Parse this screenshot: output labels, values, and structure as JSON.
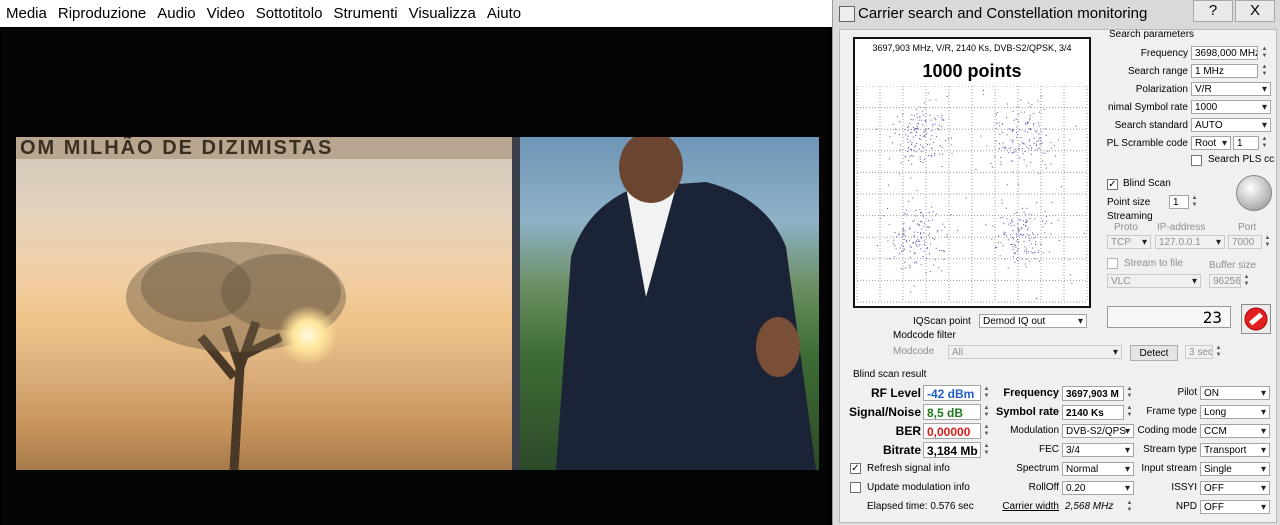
{
  "player": {
    "menu": [
      "Media",
      "Riproduzione",
      "Audio",
      "Video",
      "Sottotitolo",
      "Strumenti",
      "Visualizza",
      "Aiuto"
    ],
    "banner_text": "OM MILHÃO DE DIZIMISTAS"
  },
  "dialog": {
    "title": "Carrier search and Constellation monitoring",
    "help_btn": "?",
    "close_btn": "X",
    "constellation": {
      "info": "3697,903 MHz, V/R, 2140 Ks, DVB-S2/QPSK, 3/4",
      "points_label": "1000 points"
    },
    "search": {
      "group_title": "Search parameters",
      "frequency_label": "Frequency",
      "frequency_value": "3698,000 MHz",
      "range_label": "Search range",
      "range_value": "1 MHz",
      "polarization_label": "Polarization",
      "polarization_value": "V/R",
      "min_sr_label": "nimal Symbol rate",
      "min_sr_value": "1000",
      "standard_label": "Search standard",
      "standard_value": "AUTO",
      "pl_label": "PL Scramble code",
      "pl_type": "Root",
      "pl_value": "1",
      "search_pls_label": "Search PLS cc"
    },
    "options": {
      "blind_scan_label": "Blind Scan",
      "point_size_label": "Point size",
      "point_size_value": "1",
      "streaming_label": "Streaming",
      "proto_label": "Proto",
      "ip_label": "IP-address",
      "port_label": "Port",
      "proto_value": "TCP",
      "ip_value": "127.0.0.1",
      "port_value": "7000",
      "stream_to_file_label": "Stream to file",
      "buffer_size_label": "Buffer size",
      "player_value": "VLC",
      "buffer_value": "96256",
      "counter_value": "23"
    },
    "iq": {
      "iqscan_label": "IQScan point",
      "iqscan_value": "Demod IQ out",
      "modcode_filter_label": "Modcode filter",
      "modcode_label": "Modcode",
      "modcode_value": "All",
      "detect_label": "Detect",
      "detect_time": "3 sec"
    },
    "result": {
      "group_title": "Blind scan result",
      "rf_label": "RF Level",
      "rf_value": "-42 dBm",
      "sn_label": "Signal/Noise",
      "sn_value": "8,5 dB",
      "ber_label": "BER",
      "ber_value": "0,00000",
      "bitrate_label": "Bitrate",
      "bitrate_value": "3,184 Mb",
      "frequency_label": "Frequency",
      "frequency_value": "3697,903 M",
      "sr_label": "Symbol rate",
      "sr_value": "2140 Ks",
      "modulation_label": "Modulation",
      "modulation_value": "DVB-S2/QPS",
      "fec_label": "FEC",
      "fec_value": "3/4",
      "spectrum_label": "Spectrum",
      "spectrum_value": "Normal",
      "rolloff_label": "RollOff",
      "rolloff_value": "0.20",
      "carrier_width_label": "Carrier width",
      "carrier_width_value": "2,568 MHz",
      "pilot_label": "Pilot",
      "pilot_value": "ON",
      "frame_type_label": "Frame type",
      "frame_type_value": "Long",
      "coding_mode_label": "Coding mode",
      "coding_mode_value": "CCM",
      "stream_type_label": "Stream type",
      "stream_type_value": "Transport",
      "input_stream_label": "Input stream",
      "input_stream_value": "Single",
      "issyi_label": "ISSYI",
      "issyi_value": "OFF",
      "npd_label": "NPD",
      "npd_value": "OFF",
      "refresh_label": "Refresh signal info",
      "update_mod_label": "Update modulation info",
      "elapsed_label": "Elapsed time: 0.576 sec"
    }
  }
}
